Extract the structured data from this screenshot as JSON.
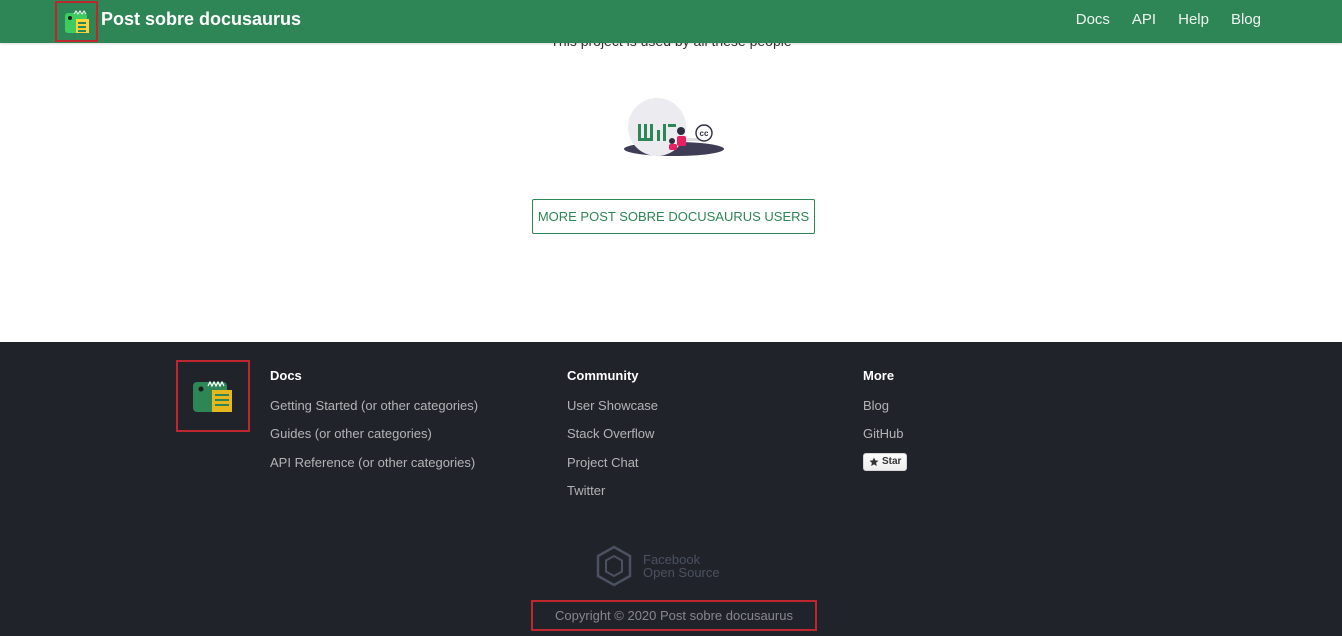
{
  "header": {
    "title": "Post sobre docusaurus",
    "logo_icon": "docusaurus-dino-icon",
    "nav": [
      "Docs",
      "API",
      "Help",
      "Blog"
    ],
    "bg_color": "#2e8555"
  },
  "main": {
    "partial_text": "This project is used by all these people",
    "showcase_image": "user-showcase-illustration",
    "more_users_button": "MORE POST SOBRE DOCUSAURUS USERS"
  },
  "footer": {
    "bg_color": "#20232a",
    "logo_icon": "docusaurus-dino-icon",
    "columns": [
      {
        "title": "Docs",
        "links": [
          "Getting Started (or other categories)",
          "Guides (or other categories)",
          "API Reference (or other categories)"
        ]
      },
      {
        "title": "Community",
        "links": [
          "User Showcase",
          "Stack Overflow",
          "Project Chat",
          "Twitter"
        ]
      },
      {
        "title": "More",
        "links": [
          "Blog",
          "GitHub"
        ]
      }
    ],
    "star_button": "Star",
    "oss_logo_text_line1": "Facebook",
    "oss_logo_text_line2": "Open Source",
    "copyright": "Copyright © 2020 Post sobre docusaurus"
  }
}
